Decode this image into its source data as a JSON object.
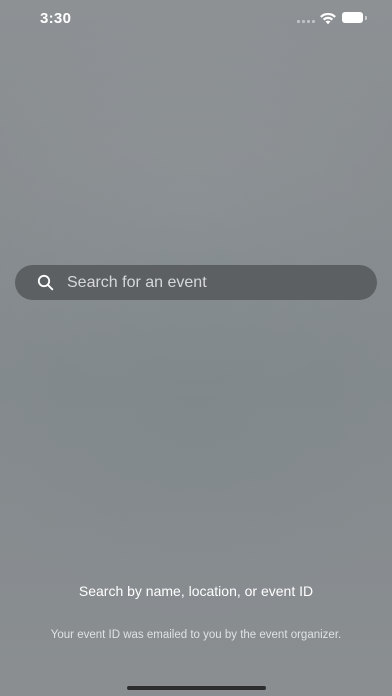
{
  "status_bar": {
    "time": "3:30",
    "icons": [
      "cellular-signal-icon",
      "wifi-icon",
      "battery-icon"
    ]
  },
  "search": {
    "placeholder": "Search for an event",
    "value": "",
    "icon": "search-icon"
  },
  "help": {
    "title": "Search by name, location, or event ID",
    "subtitle": "Your event ID was emailed to you by the event organizer."
  },
  "colors": {
    "background": "#878c8f",
    "search_field": "#5c6063",
    "text_primary": "#ffffff",
    "text_secondary": "#dfe1e3",
    "home_indicator": "#2b2d2f"
  }
}
